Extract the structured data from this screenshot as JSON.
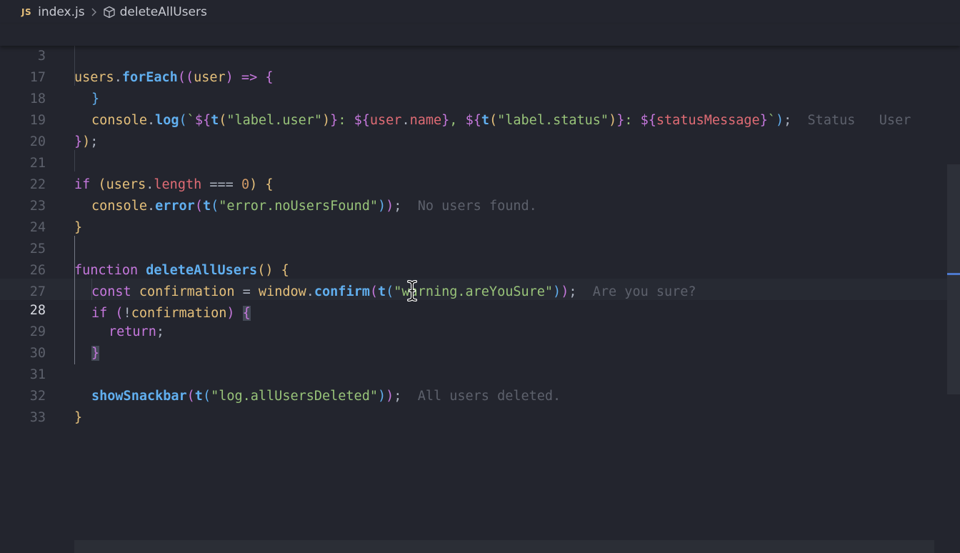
{
  "breadcrumb": {
    "file_icon": "JS",
    "file_name": "index.js",
    "separator_icon": "chevron-right-icon",
    "symbol_icon": "cube-icon",
    "symbol_name": "deleteAllUsers"
  },
  "sticky_line": {
    "number": "3",
    "tokens": {
      "obj": "users",
      "dot": ".",
      "method": "forEach",
      "open": "((",
      "param": "user",
      "close": ")",
      "arrow": " => ",
      "brace": "{"
    }
  },
  "lines": [
    {
      "number": "17"
    },
    {
      "number": "18",
      "inlay_hint": "Status   User"
    },
    {
      "number": "19"
    },
    {
      "number": "20"
    },
    {
      "number": "21"
    },
    {
      "number": "22",
      "inlay_hint": "No users found."
    },
    {
      "number": "23"
    },
    {
      "number": "24"
    },
    {
      "number": "25"
    },
    {
      "number": "26",
      "inlay_hint": "Are you sure?"
    },
    {
      "number": "27"
    },
    {
      "number": "28"
    },
    {
      "number": "29"
    },
    {
      "number": "30"
    },
    {
      "number": "31",
      "inlay_hint": "All users deleted."
    },
    {
      "number": "32"
    },
    {
      "number": "33"
    }
  ],
  "code": {
    "l18": {
      "console": "console",
      "log": "log",
      "t": "t",
      "key_user": "\"label.user\"",
      "user": "user",
      "name": "name",
      "key_status": "\"label.status\"",
      "statusMessage": "statusMessage"
    },
    "l21": {
      "if": "if",
      "users": "users",
      "length": "length",
      "op": "===",
      "zero": "0"
    },
    "l22": {
      "console": "console",
      "error": "error",
      "t": "t",
      "key": "\"error.noUsersFound\""
    },
    "l25": {
      "function": "function",
      "name": "deleteAllUsers"
    },
    "l26": {
      "const": "const",
      "var": "confirmation",
      "window": "window",
      "confirm": "confirm",
      "t": "t",
      "key": "\"warning.areYouSure\""
    },
    "l27": {
      "if": "if",
      "var": "confirmation"
    },
    "l28": {
      "return": "return"
    },
    "l31": {
      "fn": "showSnackbar",
      "t": "t",
      "key": "\"log.allUsersDeleted\""
    }
  },
  "colors": {
    "background": "#23252e",
    "keyword": "#c678dd",
    "identifier": "#e5c07b",
    "function": "#61afef",
    "property": "#e06c75",
    "string": "#98c379",
    "number": "#d19a66",
    "inlay_hint": "#5d616c"
  },
  "mouse_cursor_icon": "text-cursor-icon"
}
